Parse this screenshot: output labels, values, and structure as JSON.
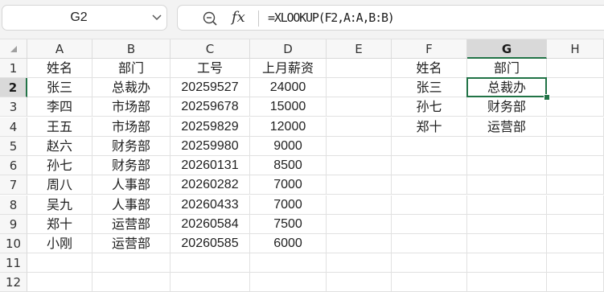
{
  "name_box": {
    "value": "G2"
  },
  "formula_bar": {
    "fx_label": "fx",
    "formula": "=XLOOKUP(F2,A:A,B:B)"
  },
  "selection": {
    "column": "G",
    "row": "2"
  },
  "columns": [
    "A",
    "B",
    "C",
    "D",
    "E",
    "F",
    "G",
    "H"
  ],
  "rows": [
    "1",
    "2",
    "3",
    "4",
    "5",
    "6",
    "7",
    "8",
    "9",
    "10",
    "11",
    "12"
  ],
  "table": {
    "headers": [
      "姓名",
      "部门",
      "工号",
      "上月薪资"
    ],
    "rows": [
      [
        "张三",
        "总裁办",
        "20259527",
        "24000"
      ],
      [
        "李四",
        "市场部",
        "20259678",
        "15000"
      ],
      [
        "王五",
        "市场部",
        "20259829",
        "12000"
      ],
      [
        "赵六",
        "财务部",
        "20259980",
        "9000"
      ],
      [
        "孙七",
        "财务部",
        "20260131",
        "8500"
      ],
      [
        "周八",
        "人事部",
        "20260282",
        "7000"
      ],
      [
        "吴九",
        "人事部",
        "20260433",
        "7000"
      ],
      [
        "郑十",
        "运营部",
        "20260584",
        "7500"
      ],
      [
        "小刚",
        "运营部",
        "20260585",
        "6000"
      ]
    ]
  },
  "lookup": {
    "headers": [
      "姓名",
      "部门"
    ],
    "rows": [
      [
        "张三",
        "总裁办"
      ],
      [
        "孙七",
        "财务部"
      ],
      [
        "郑十",
        "运营部"
      ]
    ]
  },
  "colors": {
    "accent": "#217346",
    "header_bg": "#f7f7f7",
    "selected_header_bg": "#d9d9d9"
  }
}
